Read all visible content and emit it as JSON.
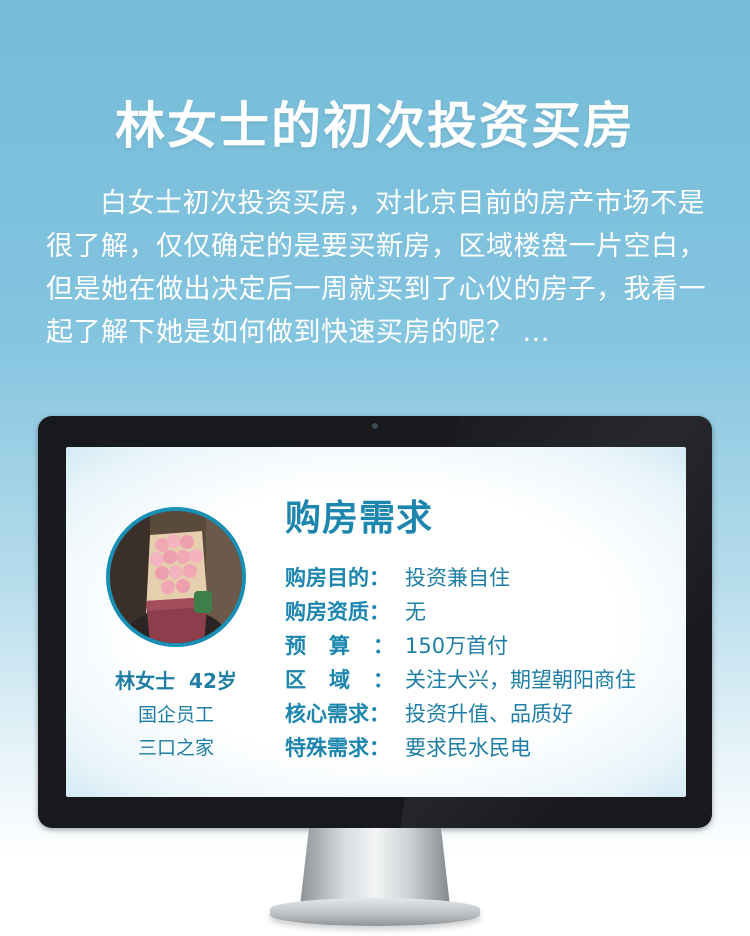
{
  "page": {
    "title": "林女士的初次投资买房",
    "intro": "白女士初次投资买房，对北京目前的房产市场不是很了解，仅仅确定的是要买新房，区域楼盘一片空白，但是她在做出决定后一周就买到了心仪的房子，我看一起了解下她是如何做到快速买房的呢？ ..."
  },
  "profile": {
    "name": "林女士  42岁",
    "job": "国企员工",
    "family": "三口之家"
  },
  "requirements": {
    "heading": "购房需求",
    "items": [
      {
        "label": "购房目的：",
        "value": "投资兼自住"
      },
      {
        "label": "购房资质：",
        "value": "无"
      },
      {
        "label": "预算：",
        "value": "150万首付"
      },
      {
        "label": "区域：",
        "value": "关注大兴，期望朝阳商住"
      },
      {
        "label": "核心需求：",
        "value": "投资升值、品质好"
      },
      {
        "label": "特殊需求：",
        "value": "要求民水民电"
      }
    ]
  },
  "colors": {
    "accent": "#1c86ae",
    "background_top": "#75bcd8",
    "monitor_frame": "#17191c"
  },
  "icons": {
    "avatar": "woman-with-flower-bouquet-photo"
  }
}
